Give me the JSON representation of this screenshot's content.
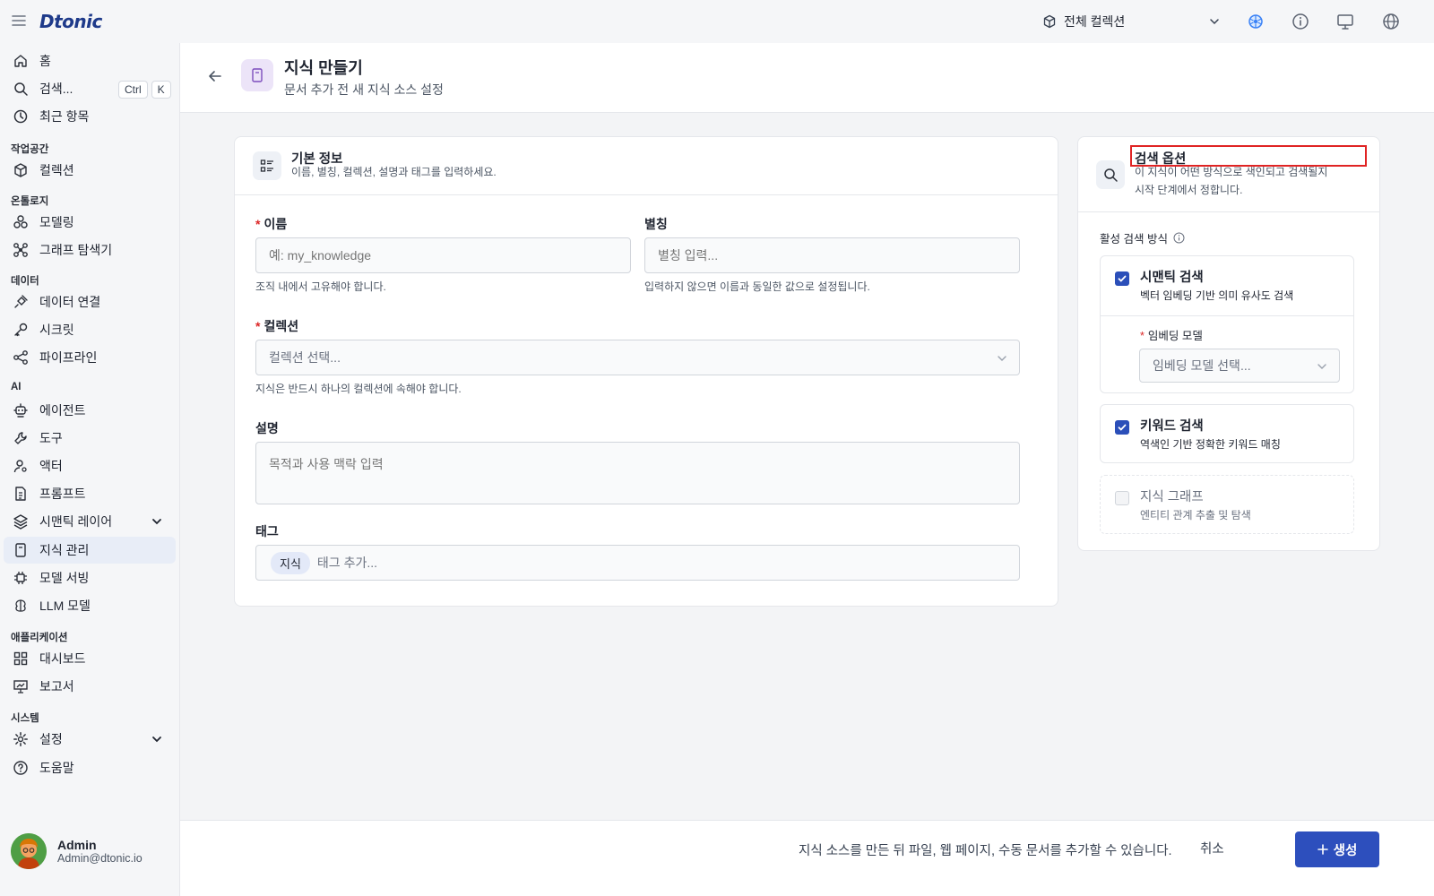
{
  "app": {
    "logo": "Dtonic"
  },
  "topbar": {
    "collection_label": "전체 컬렉션",
    "icons": [
      "kubernetes-icon",
      "info-icon",
      "monitor-icon",
      "globe-icon"
    ]
  },
  "sidebar": {
    "home": "홈",
    "search": "검색...",
    "search_kbd_ctrl": "Ctrl",
    "search_kbd_k": "K",
    "recent": "최근 항목",
    "section_workspace": "작업공간",
    "collection": "컬렉션",
    "section_ontology": "온톨로지",
    "modeling": "모델링",
    "graph_explorer": "그래프 탐색기",
    "section_data": "데이터",
    "data_connection": "데이터 연결",
    "secret": "시크릿",
    "pipeline": "파이프라인",
    "section_ai": "AI",
    "agent": "에이전트",
    "tool": "도구",
    "actor": "액터",
    "prompt": "프롬프트",
    "semantic_layer": "시맨틱 레이어",
    "knowledge_mgmt": "지식 관리",
    "model_serving": "모델 서빙",
    "llm_model": "LLM 모델",
    "section_application": "애플리케이션",
    "dashboard": "대시보드",
    "report": "보고서",
    "section_system": "시스템",
    "settings": "설정",
    "help": "도움말"
  },
  "user": {
    "name": "Admin",
    "email": "Admin@dtonic.io"
  },
  "header": {
    "title": "지식 만들기",
    "subtitle": "문서 추가 전 새 지식 소스 설정"
  },
  "basic": {
    "title": "기본 정보",
    "desc": "이름, 별칭, 컬렉션, 설명과 태그를 입력하세요.",
    "name_label": "이름",
    "name_placeholder": "예: my_knowledge",
    "name_hint": "조직 내에서 고유해야 합니다.",
    "alias_label": "별칭",
    "alias_placeholder": "별칭 입력...",
    "alias_hint": "입력하지 않으면 이름과 동일한 값으로 설정됩니다.",
    "collection_label": "컬렉션",
    "collection_placeholder": "컬렉션 선택...",
    "collection_hint": "지식은 반드시 하나의 컬렉션에 속해야 합니다.",
    "desc_label": "설명",
    "desc_placeholder": "목적과 사용 맥락 입력",
    "tag_label": "태그",
    "tag_chip": "지식",
    "tag_placeholder": "태그 추가..."
  },
  "search_opts": {
    "title": "검색 옵션",
    "desc_line1": "이 지식이 어떤 방식으로 색인되고 검색될지",
    "desc_line2": "시작 단계에서 정합니다.",
    "active_label": "활성 검색 방식",
    "semantic_title": "시맨틱 검색",
    "semantic_desc": "벡터 임베딩 기반 의미 유사도 검색",
    "embedding_label": "임베딩 모델",
    "embedding_placeholder": "임베딩 모델 선택...",
    "keyword_title": "키워드 검색",
    "keyword_desc": "역색인 기반 정확한 키워드 매칭",
    "graph_title": "지식 그래프",
    "graph_desc": "엔티티 관계 추출 및 탐색",
    "semantic_checked": true,
    "keyword_checked": true,
    "graph_checked": false
  },
  "footer": {
    "message": "지식 소스를 만든 뒤 파일, 웹 페이지, 수동 문서를 추가할 수 있습니다.",
    "cancel": "취소",
    "create": "생성"
  },
  "colors": {
    "primary": "#2d4fbd",
    "active_nav": "#e8edf7",
    "highlight": "#e02424"
  }
}
